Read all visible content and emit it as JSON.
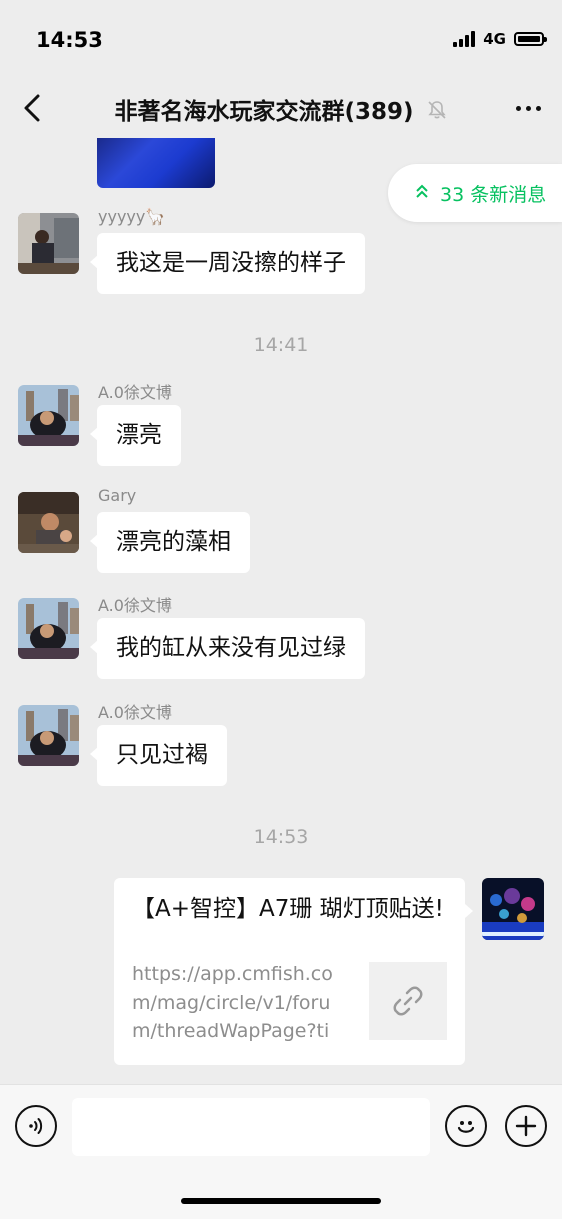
{
  "status_bar": {
    "time": "14:53",
    "network": "4G"
  },
  "nav": {
    "title": "非著名海水玩家交流群(389)",
    "back_icon": "chevron-left-icon",
    "more_icon": "more-dots-icon",
    "mute_icon": "bell-muted-icon"
  },
  "new_messages": {
    "label": "33 条新消息",
    "icon": "double-chevron-up-icon",
    "color": "#07c160"
  },
  "messages": [
    {
      "sender": "yyyyy🦙",
      "text": "我这是一周没擦的样子"
    },
    {
      "sender": "A.0徐文博",
      "text": "漂亮"
    },
    {
      "sender": "Gary",
      "text": "漂亮的藻相"
    },
    {
      "sender": "A.0徐文博",
      "text": "我的缸从来没有见过绿"
    },
    {
      "sender": "A.0徐文博",
      "text": "只见过褐"
    }
  ],
  "timestamps": [
    "14:41",
    "14:53"
  ],
  "link_card": {
    "title": "【A+智控】A7珊 瑚灯顶贴送!",
    "url": "https://app.cmfish.com/mag/circle/v1/forum/threadWapPage?tid...",
    "thumb_icon": "link-icon"
  },
  "input_bar": {
    "voice_icon": "voice-icon",
    "emoji_icon": "emoji-icon",
    "add_icon": "plus-icon",
    "input_value": ""
  }
}
